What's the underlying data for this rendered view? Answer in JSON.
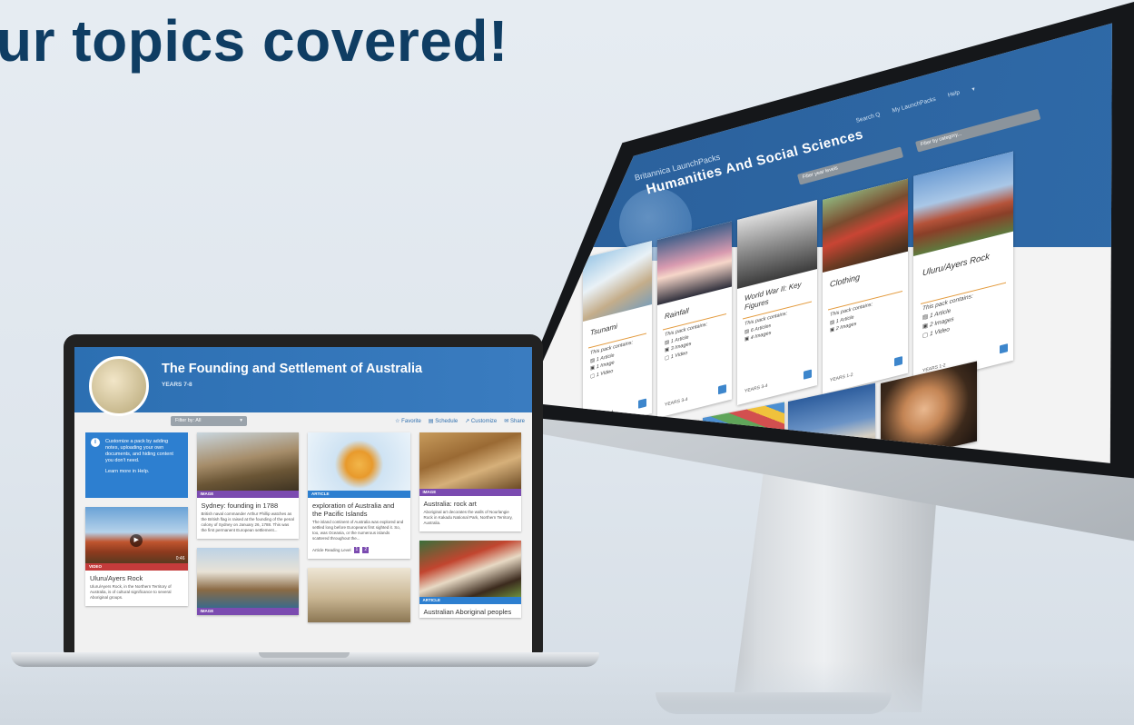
{
  "headline": "ur topics covered!",
  "laptop": {
    "title": "The Founding and Settlement of Australia",
    "subtitle": "YEARS 7-8",
    "filter": {
      "label": "Filter by: All",
      "caret": "▾"
    },
    "actions": {
      "favorite": "☆ Favorite",
      "schedule": "▤ Schedule",
      "customize": "↗ Customize",
      "share": "✉ Share"
    },
    "tip": {
      "icon": "i",
      "text": "Customize a pack by adding notes, uploading your own documents, and hiding content you don't need.",
      "help": "Learn more in Help."
    },
    "cards": [
      {
        "type": "VIDEO",
        "duration": "0:46",
        "title": "Uluru/Ayers Rock",
        "text": "Uluru/Ayers Rock, in the Northern Territory of Australia, is of cultural significance to several Aboriginal groups.",
        "color": "#c43b3b"
      },
      {
        "type": "IMAGE",
        "title": "Sydney: founding in 1788",
        "text": "British naval commander Arthur Phillip watches as the British flag is raised at the founding of the penal colony of Sydney on January 26, 1788. This was the first permanent European settlement...",
        "color": "#7b4bb0"
      },
      {
        "type": "IMAGE",
        "title": "",
        "text": "",
        "color": "#7b4bb0"
      },
      {
        "type": "ARTICLE",
        "title": "exploration of Australia and the Pacific Islands",
        "text": "The island continent of Australia was explored and settled long before Europeans first sighted it. So, too, was Oceania, or the numerous islands scattered throughout the...",
        "reading": "Article Reading Level",
        "levels": [
          "1",
          "2"
        ],
        "color": "#2d7fd0"
      },
      {
        "type": "IMAGE",
        "title": "Australia: rock art",
        "text": "Aboriginal art decorates the walls of Nourlangie Rock in Kakadu National Park, Northern Territory, Australia.",
        "color": "#7b4bb0"
      },
      {
        "type": "ARTICLE",
        "title": "Australian Aboriginal peoples",
        "text": "",
        "color": "#2d7fd0"
      }
    ]
  },
  "monitor": {
    "brand": "Britannica LaunchPacks",
    "title": "Humanities And Social Sciences",
    "nav": [
      "Search Q",
      "My LaunchPacks",
      "Help",
      "▾"
    ],
    "filter_year": "Filter year levels",
    "filter_category": "Filter by category...",
    "cards": [
      {
        "title": "Tsunami",
        "contains": "This pack contains:",
        "items": [
          "▤ 1 Article",
          "▣ 1 Image",
          "▢ 1 Video"
        ],
        "years": "YEARS 3-4"
      },
      {
        "title": "Rainfall",
        "contains": "This pack contains:",
        "items": [
          "▤ 1 Article",
          "▣ 3 Images",
          "▢ 1 Video"
        ],
        "years": "YEARS 3-4"
      },
      {
        "title": "World War II: Key Figures",
        "contains": "This pack contains:",
        "items": [
          "▤ 6 Articles",
          "▣ 4 Images"
        ],
        "years": "YEARS 3-4"
      },
      {
        "title": "Clothing",
        "contains": "This pack contains:",
        "items": [
          "▤ 1 Article",
          "▣ 2 Images"
        ],
        "years": "YEARS 1-2"
      },
      {
        "title": "Uluru/Ayers Rock",
        "contains": "This pack contains:",
        "items": [
          "▤ 1 Article",
          "▣ 2 Images",
          "▢ 1 Video"
        ],
        "years": "YEARS 1-2"
      }
    ]
  }
}
